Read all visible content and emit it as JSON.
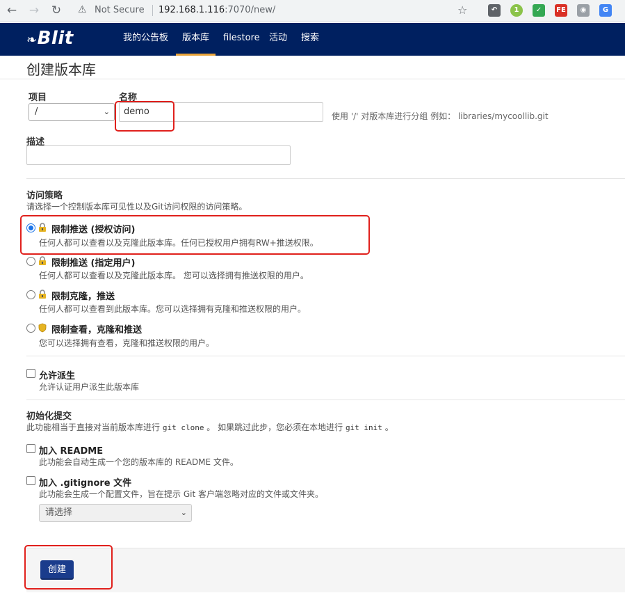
{
  "browser": {
    "security_label": "Not Secure",
    "url_host": "192.168.1.116",
    "url_rest": ":7070/new/",
    "ext_badge": "1",
    "ext_fe": "FE"
  },
  "app": {
    "logo_prefix": "❧",
    "logo_text": "Blit",
    "nav": [
      "我的公告板",
      "版本库",
      "filestore",
      "活动",
      "搜索"
    ]
  },
  "page": {
    "title": "创建版本库"
  },
  "form": {
    "project_label": "项目",
    "project_value": "/",
    "name_label": "名称",
    "name_value": "demo",
    "name_hint": "使用 '/' 对版本库进行分组 例如： libraries/mycoollib.git",
    "desc_label": "描述",
    "desc_value": "",
    "access_title": "访问策略",
    "access_desc": "请选择一个控制版本库可见性以及Git访问权限的访问策略。",
    "access_options": [
      {
        "title": "限制推送 (授权访问)",
        "desc": "任何人都可以查看以及克隆此版本库。任何已授权用户拥有RW+推送权限。",
        "selected": true
      },
      {
        "title": "限制推送 (指定用户)",
        "desc": "任何人都可以查看以及克隆此版本库。 您可以选择拥有推送权限的用户。",
        "selected": false
      },
      {
        "title": "限制克隆，推送",
        "desc": "任何人都可以查看到此版本库。您可以选择拥有克隆和推送权限的用户。",
        "selected": false
      },
      {
        "title": "限制查看，克隆和推送",
        "desc": "您可以选择拥有查看，克隆和推送权限的用户。",
        "selected": false
      }
    ],
    "fork_title": "允许派生",
    "fork_desc": "允许认证用户派生此版本库",
    "init_title": "初始化提交",
    "init_desc_pre": "此功能相当于直接对当前版本库进行",
    "init_code1": "git clone",
    "init_desc_mid": "。 如果跳过此步，您必须在本地进行",
    "init_code2": "git init",
    "init_desc_post": "。",
    "readme_title": "加入 README",
    "readme_desc": "此功能会自动生成一个您的版本库的 README 文件。",
    "gitignore_title": "加入 .gitignore 文件",
    "gitignore_desc": "此功能会生成一个配置文件，旨在提示 Git 客户端忽略对应的文件或文件夹。",
    "gitignore_select": "请选择",
    "create_label": "创建"
  }
}
